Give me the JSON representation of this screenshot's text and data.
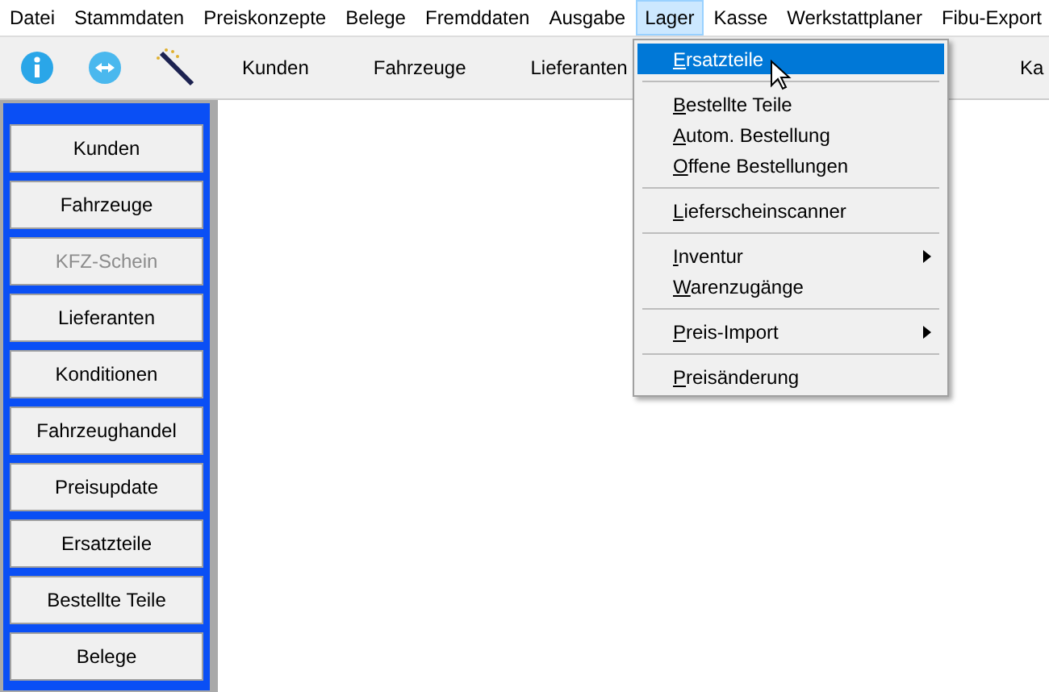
{
  "menubar": [
    {
      "label": "Datei",
      "selected": false
    },
    {
      "label": "Stammdaten",
      "selected": false
    },
    {
      "label": "Preiskonzepte",
      "selected": false
    },
    {
      "label": "Belege",
      "selected": false
    },
    {
      "label": "Fremddaten",
      "selected": false
    },
    {
      "label": "Ausgabe",
      "selected": false
    },
    {
      "label": "Lager",
      "selected": true
    },
    {
      "label": "Kasse",
      "selected": false
    },
    {
      "label": "Werkstattplaner",
      "selected": false
    },
    {
      "label": "Fibu-Export",
      "selected": false
    }
  ],
  "toolbar": {
    "buttons": [
      "Kunden",
      "Fahrzeuge",
      "Lieferanten"
    ],
    "right_button": "Ka"
  },
  "sidebar": [
    {
      "label": "Kunden",
      "disabled": false
    },
    {
      "label": "Fahrzeuge",
      "disabled": false
    },
    {
      "label": "KFZ-Schein",
      "disabled": true
    },
    {
      "label": "Lieferanten",
      "disabled": false
    },
    {
      "label": "Konditionen",
      "disabled": false
    },
    {
      "label": "Fahrzeughandel",
      "disabled": false
    },
    {
      "label": "Preisupdate",
      "disabled": false
    },
    {
      "label": "Ersatzteile",
      "disabled": false
    },
    {
      "label": "Bestellte Teile",
      "disabled": false
    },
    {
      "label": "Belege",
      "disabled": false
    }
  ],
  "dropdown": [
    {
      "kind": "item",
      "label": "Ersatzteile",
      "selected": true,
      "submenu": false
    },
    {
      "kind": "separator"
    },
    {
      "kind": "item",
      "label": "Bestellte Teile",
      "selected": false,
      "submenu": false
    },
    {
      "kind": "item",
      "label": "Autom. Bestellung",
      "selected": false,
      "submenu": false
    },
    {
      "kind": "item",
      "label": "Offene Bestellungen",
      "selected": false,
      "submenu": false
    },
    {
      "kind": "separator"
    },
    {
      "kind": "item",
      "label": "Lieferscheinscanner",
      "selected": false,
      "submenu": false
    },
    {
      "kind": "separator"
    },
    {
      "kind": "item",
      "label": "Inventur",
      "selected": false,
      "submenu": true
    },
    {
      "kind": "item",
      "label": "Warenzugänge",
      "selected": false,
      "submenu": false
    },
    {
      "kind": "separator"
    },
    {
      "kind": "item",
      "label": "Preis-Import",
      "selected": false,
      "submenu": true
    },
    {
      "kind": "separator"
    },
    {
      "kind": "item",
      "label": "Preisänderung",
      "selected": false,
      "submenu": false
    }
  ]
}
